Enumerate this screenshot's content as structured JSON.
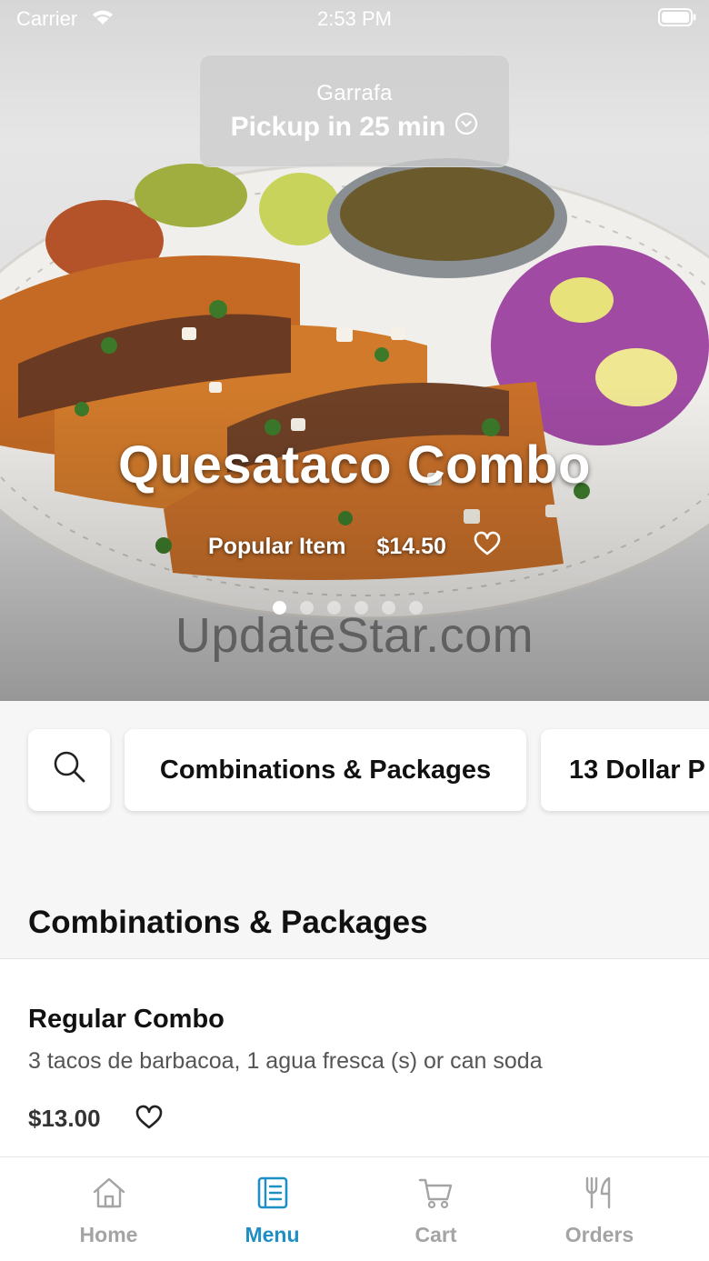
{
  "status_bar": {
    "carrier": "Carrier",
    "time": "2:53 PM"
  },
  "pickup": {
    "store": "Garrafa",
    "time_label": "Pickup in 25 min"
  },
  "hero": {
    "title": "Quesataco Combo",
    "tag": "Popular Item",
    "price": "$14.50",
    "slides_total": 6,
    "active_slide": 1
  },
  "watermark": "UpdateStar.com",
  "categories": {
    "search_icon": "search-icon",
    "items": [
      "Combinations & Packages",
      "13 Dollar P"
    ]
  },
  "section": {
    "title": "Combinations & Packages"
  },
  "item": {
    "name": "Regular Combo",
    "description": "3 tacos de barbacoa, 1 agua fresca (s) or can soda",
    "price": "$13.00"
  },
  "tabbar": {
    "tabs": [
      {
        "label": "Home",
        "icon": "home-icon"
      },
      {
        "label": "Menu",
        "icon": "menu-icon"
      },
      {
        "label": "Cart",
        "icon": "cart-icon"
      },
      {
        "label": "Orders",
        "icon": "utensils-icon"
      }
    ],
    "active": "Menu"
  },
  "colors": {
    "accent": "#1e8fc4",
    "inactive": "#a4a4a4"
  }
}
